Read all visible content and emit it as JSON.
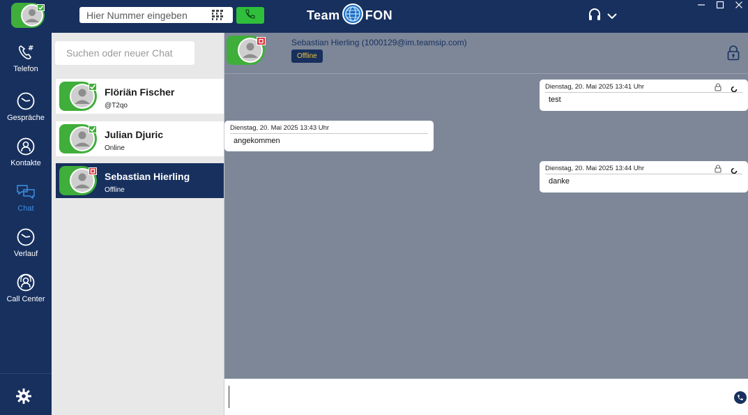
{
  "topbar": {
    "dial_placeholder": "Hier Nummer eingeben",
    "logo_left": "Team",
    "logo_right": "FON"
  },
  "nav": {
    "items": [
      {
        "label": "Telefon",
        "icon": "phone-hash-icon"
      },
      {
        "label": "Gespräche",
        "icon": "clock-icon"
      },
      {
        "label": "Kontakte",
        "icon": "contacts-icon"
      },
      {
        "label": "Chat",
        "icon": "chat-bubbles-icon",
        "active": true
      },
      {
        "label": "Verlauf",
        "icon": "history-icon"
      },
      {
        "label": "Call Center",
        "icon": "call-center-icon"
      }
    ],
    "settings_icon": "gear-icon"
  },
  "contacts": {
    "search_placeholder": "Suchen oder neuer Chat",
    "list": [
      {
        "name": "Flöriän Fischer",
        "status": "@T2qo",
        "presence": "online"
      },
      {
        "name": "Julian Djuric",
        "status": "Online",
        "presence": "online"
      },
      {
        "name": "Sebastian Hierling",
        "status": "Offline",
        "presence": "offline",
        "selected": true
      }
    ]
  },
  "chat": {
    "header_name": "Sebastian Hierling (1000129@im.teamsip.com)",
    "header_status": "Offline",
    "messages": [
      {
        "date": "Dienstag, 20. Mai 2025 13:41 Uhr",
        "text": "test",
        "direction": "out"
      },
      {
        "date": "Dienstag, 20. Mai 2025 13:43 Uhr",
        "text": "angekommen",
        "direction": "in"
      },
      {
        "date": "Dienstag, 20. Mai 2025 13:44 Uhr",
        "text": "danke",
        "direction": "out"
      }
    ]
  },
  "colors": {
    "navy": "#17305e",
    "presence_online": "#3fae3a",
    "presence_offline": "#d9323a",
    "call_green": "#2fbf3b",
    "chat_bg": "#7d8798",
    "active_nav": "#3d8fe0",
    "offline_badge_text": "#f0c23a"
  }
}
